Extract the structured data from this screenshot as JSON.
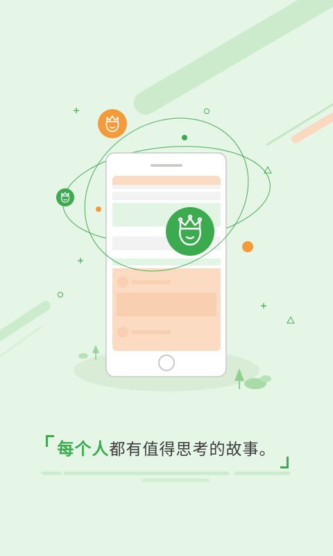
{
  "splash": {
    "tagline_emphasis": "每个人",
    "tagline_rest": "都有值得思考的故事。"
  },
  "icons": [
    "phone-icon",
    "crown-face-icon",
    "plus-icon",
    "circle-icon",
    "triangle-icon",
    "tree-icon"
  ],
  "colors": {
    "background": "#e6f6e6",
    "brand_green": "#3cab4f",
    "accent_orange": "#f39b3a",
    "light_peach": "#fbdcc2"
  }
}
